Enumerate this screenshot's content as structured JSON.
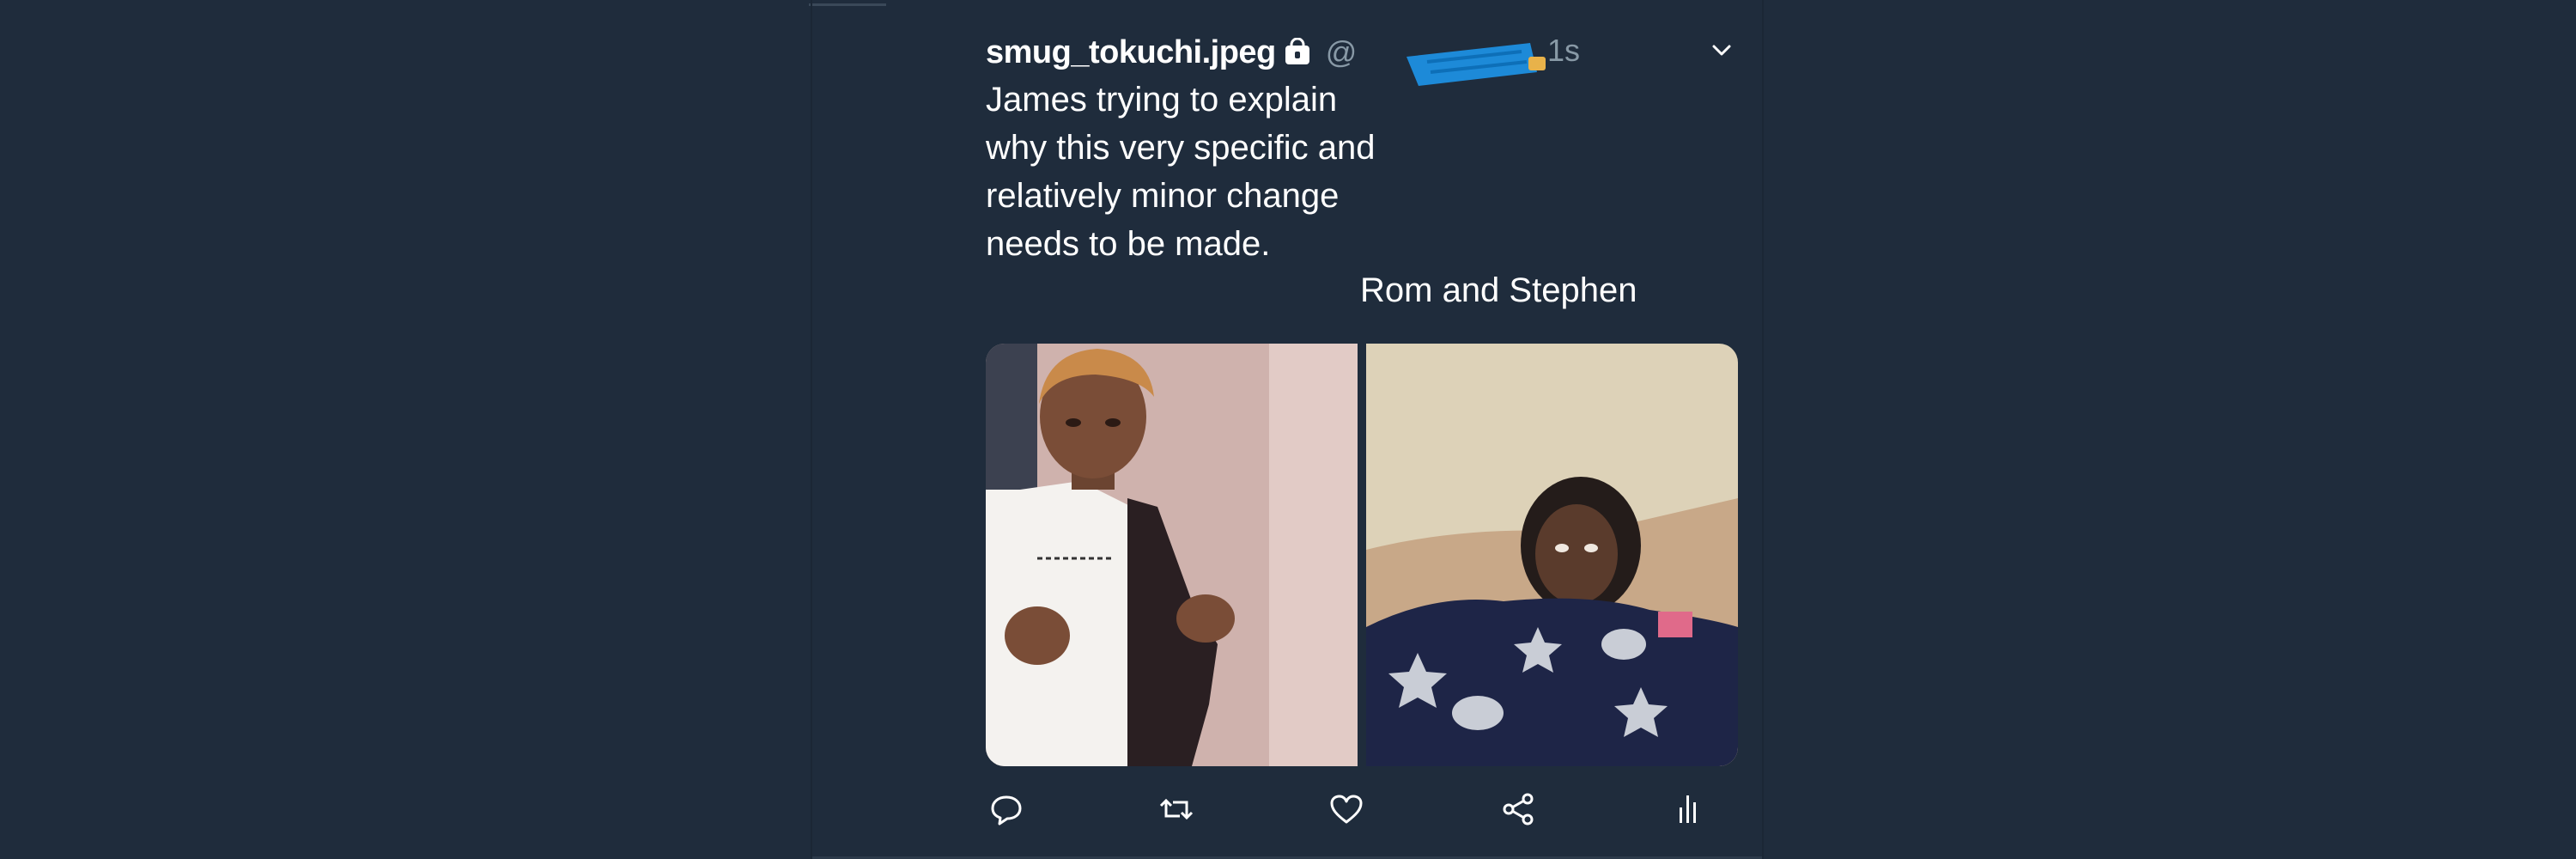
{
  "tweet": {
    "display_name": "smug_tokuchi.jpeg",
    "handle": "@",
    "timestamp": "1s",
    "caption_left": "James trying to explain why this very specific and relatively minor change needs to be made.",
    "caption_right": "Rom and Stephen"
  },
  "icons": {
    "lock": "lock-icon",
    "menu": "chevron-down-icon",
    "reply": "reply-icon",
    "retweet": "retweet-icon",
    "like": "heart-icon",
    "share": "share-icon",
    "analytics": "analytics-icon"
  },
  "colors": {
    "background": "#1f2c3c",
    "text": "#ffffff",
    "muted": "#8899a6",
    "redaction": "#1da1f2"
  }
}
